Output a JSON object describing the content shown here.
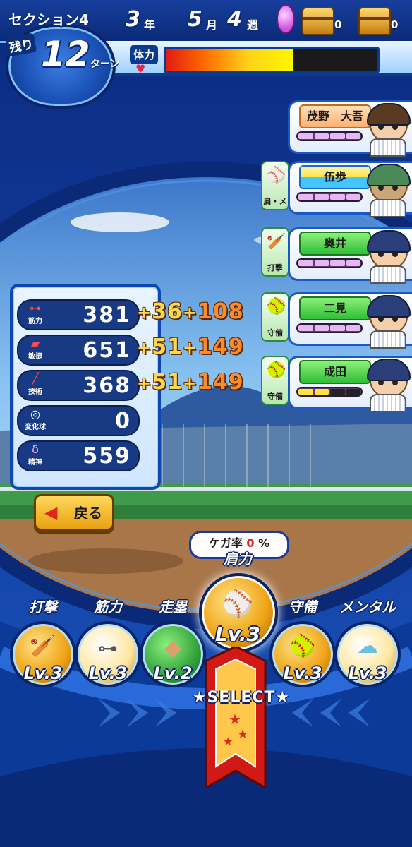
{
  "header": {
    "section": "セクション4",
    "remaining_label": "残り",
    "turns": "12",
    "turn_unit": "ターン",
    "year": "3",
    "year_unit": "年",
    "month": "5",
    "month_unit": "月",
    "week": "4",
    "week_unit": "週",
    "chest1_count": "0",
    "chest2_count": "0",
    "stamina_label": "体力",
    "stamina_level": 0.6
  },
  "partners": [
    {
      "name": "茂野　大吾",
      "event": ""
    },
    {
      "name": "伍歩",
      "event": "肩・メ"
    },
    {
      "name": "奥井",
      "event": "打撃"
    },
    {
      "name": "二見",
      "event": "守備"
    },
    {
      "name": "成田",
      "event": "守備"
    }
  ],
  "stats": [
    {
      "label": "筋力",
      "value": "381",
      "bonus1": "36",
      "bonus2": "108",
      "icon": "dumbbell-icon"
    },
    {
      "label": "敏捷",
      "value": "651",
      "bonus1": "51",
      "bonus2": "149",
      "icon": "shoe-icon"
    },
    {
      "label": "技術",
      "value": "368",
      "bonus1": "51",
      "bonus2": "149",
      "icon": "bat-icon"
    },
    {
      "label": "変化球",
      "value": "0",
      "icon": "ball-icon"
    },
    {
      "label": "精神",
      "value": "559",
      "icon": "spirit-icon"
    }
  ],
  "plus_sign": "+",
  "back_label": "戻る",
  "injury": {
    "label": "ケガ率",
    "value": "0",
    "unit": "%"
  },
  "training": [
    {
      "label": "打撃",
      "level": "Lv.3",
      "icon": "bat-icon"
    },
    {
      "label": "筋力",
      "level": "Lv.3",
      "icon": "dumbbell-icon"
    },
    {
      "label": "走塁",
      "level": "Lv.2",
      "icon": "base-icon"
    },
    {
      "label": "肩力",
      "level": "Lv.3",
      "icon": "ball-icon",
      "selected": true
    },
    {
      "label": "守備",
      "level": "Lv.3",
      "icon": "glove-icon"
    },
    {
      "label": "メンタル",
      "level": "Lv.3",
      "icon": "cloud-icon"
    }
  ],
  "select_label": "SELECT"
}
